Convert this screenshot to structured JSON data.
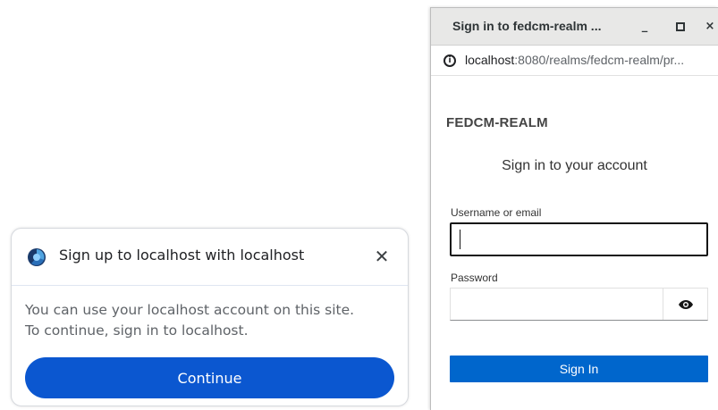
{
  "fedcm_dialog": {
    "title": "Sign up to localhost with localhost",
    "close_icon": "close-icon",
    "body_line1": "You can use your localhost account on this site.",
    "body_line2": "To continue, sign in to localhost.",
    "continue_label": "Continue",
    "accent_color": "#0b57d0"
  },
  "popup_window": {
    "title": "Sign in to fedcm-realm ...",
    "controls": {
      "minimize": "_",
      "maximize": "▫",
      "close": "×"
    },
    "url_host": "localhost",
    "url_rest": ":8080/realms/fedcm-realm/pr...",
    "security_icon": "info-icon"
  },
  "login_form": {
    "realm_name": "FEDCM-REALM",
    "heading": "Sign in to your account",
    "username_label": "Username or email",
    "username_value": "",
    "password_label": "Password",
    "password_value": "",
    "show_password_icon": "eye-icon",
    "signin_label": "Sign In",
    "button_color": "#0066cc"
  }
}
